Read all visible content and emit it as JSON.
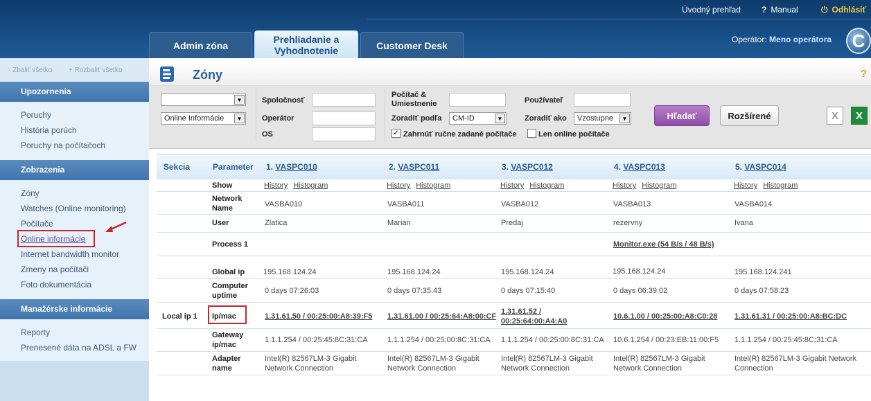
{
  "top_links": {
    "home": "Úvodný prehľad",
    "manual": "Manual",
    "logout": "Odhlásiť"
  },
  "tabs": [
    {
      "label": "Admin zóna"
    },
    {
      "label": "Prehliadanie a Vyhodnotenie"
    },
    {
      "label": "Customer Desk"
    }
  ],
  "operator": {
    "label": "Operátor:",
    "name": "Meno operátora"
  },
  "sidebar": {
    "collapse_all": "- Zbaliť všetko",
    "expand_all": "+ Rozbaliť všetko",
    "sections": [
      {
        "title": "Upozornenia",
        "items": [
          "Poruchy",
          "História porúch",
          "Poruchy na počítačoch"
        ]
      },
      {
        "title": "Zobrazenia",
        "items": [
          "Zóny",
          "Watches (Online monitoring)",
          "Počítače",
          "Online informácie",
          "Internet bandwidth monitor",
          "Zmeny na počítači",
          "Foto dokumentácia"
        ]
      },
      {
        "title": "Manažérske informácie",
        "items": [
          "Reporty",
          "Prenesené dáta na ADSL a FW"
        ]
      }
    ]
  },
  "page_title": "Zóny",
  "filters": {
    "select1_value": "",
    "select2_value": "Online Informácie",
    "company_label": "Spoločnosť",
    "operator_label": "Operátor",
    "os_label": "OS",
    "computer_label_1": "Počítač &",
    "computer_label_2": "Umiestnenie",
    "sort_by_label": "Zoradiť podľa",
    "sort_by_value": "CM-ID",
    "user_label": "Používateľ",
    "sort_as_label": "Zoradiť ako",
    "sort_as_value": "Vzostupne",
    "include_manual": "Zahrnúť ručne zadané počítače",
    "include_manual_checked": true,
    "online_only": "Len online počítače",
    "online_only_checked": false,
    "search_button": "Hľadať",
    "advanced_button": "Rozšírené"
  },
  "table": {
    "section_header": "Sekcia",
    "param_header": "Parameter",
    "columns": [
      {
        "num": "1.",
        "pc": "VASPC010"
      },
      {
        "num": "2.",
        "pc": "VASPC011"
      },
      {
        "num": "3.",
        "pc": "VASPC012"
      },
      {
        "num": "4.",
        "pc": "VASPC013"
      },
      {
        "num": "5.",
        "pc": "VASPC014"
      }
    ],
    "history": "History",
    "histogram": "Histogram",
    "params": {
      "show": "Show",
      "network_name_1": "Network",
      "network_name_2": "Name",
      "user": "User",
      "process": "Process 1",
      "global_ip": "Global ip",
      "uptime_1": "Computer",
      "uptime_2": "uptime",
      "ipmac": "Ip/mac",
      "gateway_1": "Gateway",
      "gateway_2": "ip/mac",
      "adapter_1": "Adapter",
      "adapter_2": "name"
    },
    "local_ip_section": "Local ip 1",
    "network_names": [
      "VASBA010",
      "VASBA011",
      "VASBA012",
      "VASBA013",
      "VASBA014"
    ],
    "users": [
      "Zlatica",
      "Marian",
      "Predaj",
      "rezervny",
      "Ivana"
    ],
    "process_4": "Monitor.exe (54 B/s / 48 B/s)",
    "global_ips": [
      "195.168.124.24",
      "195.168.124.24",
      "195.168.124.24",
      "195.168.124.24",
      "195.168.124.241"
    ],
    "uptimes": [
      "0 days 07:26:03",
      "0 days 07:35:43",
      "0 days 07:15:40",
      "0 days 06:39:02",
      "0 days 07:58:23"
    ],
    "ipmac": [
      "1.31.61.50 / 00:25:00:A8:39:F5",
      "1.31.61.00 / 00:25:64:A8:00:CF",
      "1.31.61.52 /",
      "10.6.1.00 / 00:25:00:A8:C0:28",
      "1.31.61.31 / 00:25:00:A8:BC:DC"
    ],
    "ipmac_3b": "00:25:64:00:A4:A0",
    "gateways": [
      "1.1.1.254 / 00:25:45:8C:31:CA",
      "1.1.1.254 / 00:25:00:8C:31:CA",
      "1.1.1.254 / 00:25:00:8C:31:CA",
      "10.6.1.254 / 00:23:EB:11:00:F5",
      "1.1.1.254 / 00:25:45:8C:31:CA"
    ],
    "adapters_1": [
      "Intel(R) 82567LM-3 Gigabit",
      "Intel(R) 82567LM-3 Gigabit",
      "Intel(R) 82567LM-3 Gigabit",
      "Intel(R) 82567LM-3 Gigabit",
      "Intel(R) 82567LM-3 Gigabit Network"
    ],
    "adapters_2": [
      "Network Connection",
      "Network Connection",
      "Network Connection",
      "Network Connection",
      "Connection"
    ]
  }
}
